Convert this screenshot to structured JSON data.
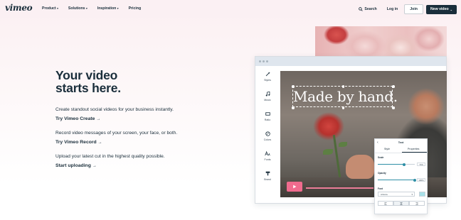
{
  "nav": {
    "logo": "vimeo",
    "menu": [
      {
        "label": "Product",
        "has_dropdown": true
      },
      {
        "label": "Solutions",
        "has_dropdown": true
      },
      {
        "label": "Inspiration",
        "has_dropdown": true
      },
      {
        "label": "Pricing",
        "has_dropdown": false
      }
    ],
    "search_label": "Search",
    "login_label": "Log in",
    "join_label": "Join",
    "new_video_label": "New video"
  },
  "hero": {
    "title_line1": "Your video",
    "title_line2": "starts here.",
    "blocks": [
      {
        "text": "Create standout social videos for your business instantly.",
        "link": "Try Vimeo Create"
      },
      {
        "text": "Record video messages of your screen, your face, or both.",
        "link": "Try Vimeo Record"
      },
      {
        "text": "Upload your latest cut in the highest quality possible.",
        "link": "Start uploading"
      }
    ]
  },
  "editor": {
    "tools": [
      "Styles",
      "Music",
      "Ratio",
      "Colors",
      "Fonts",
      "Brand"
    ],
    "caption": "Made by hand.",
    "panel": {
      "title": "Text",
      "tabs": [
        "Style",
        "Properties"
      ],
      "active_tab": "Properties",
      "scale_label": "Scale",
      "scale_value": "71%",
      "scale_fraction": 0.71,
      "opacity_label": "Opacity",
      "opacity_value": "100%",
      "opacity_fraction": 1.0,
      "font_label": "Font",
      "font_value": "Arboria",
      "text_color": "#a8e0e8"
    }
  },
  "colors": {
    "brand_dark": "#1a2e3b",
    "accent_pink": "#f06b8e",
    "accent_teal": "#2f8fa6"
  }
}
